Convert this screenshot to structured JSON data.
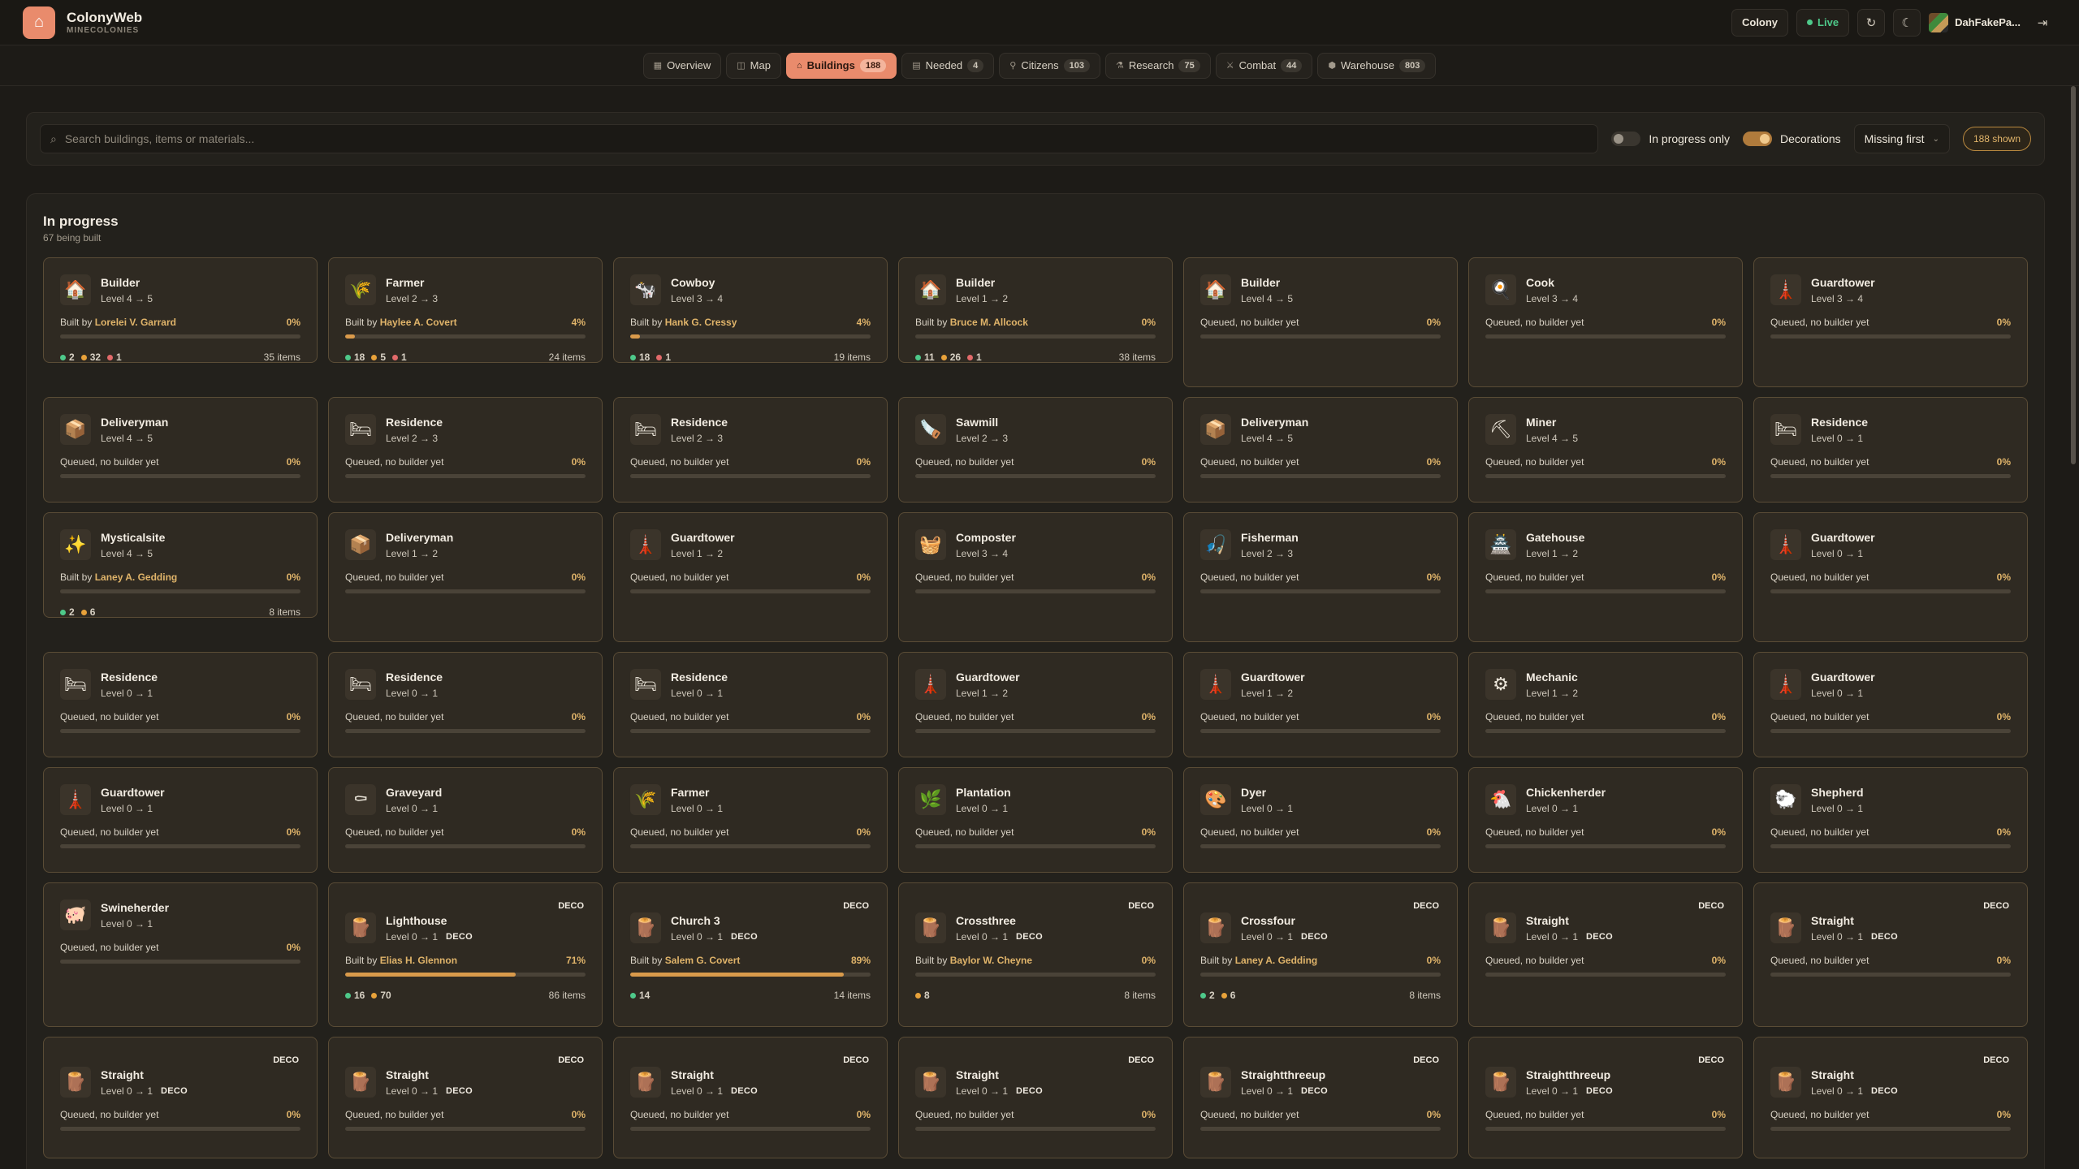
{
  "app": {
    "title": "ColonyWeb",
    "subtitle": "MINECOLONIES"
  },
  "header": {
    "colony_label": "Colony",
    "live_label": "Live",
    "user_name": "DahFakePa..."
  },
  "nav": [
    {
      "label": "Overview",
      "icon": "grid-icon",
      "glyph": "▦",
      "count": ""
    },
    {
      "label": "Map",
      "icon": "map-icon",
      "glyph": "◫",
      "count": ""
    },
    {
      "label": "Buildings",
      "icon": "building-icon",
      "glyph": "⌂",
      "count": "188",
      "active": true
    },
    {
      "label": "Needed",
      "icon": "clipboard-icon",
      "glyph": "▤",
      "count": "4"
    },
    {
      "label": "Citizens",
      "icon": "person-icon",
      "glyph": "⚲",
      "count": "103"
    },
    {
      "label": "Research",
      "icon": "flask-icon",
      "glyph": "⚗",
      "count": "75"
    },
    {
      "label": "Combat",
      "icon": "sword-icon",
      "glyph": "⚔",
      "count": "44"
    },
    {
      "label": "Warehouse",
      "icon": "box-icon",
      "glyph": "⬢",
      "count": "803"
    }
  ],
  "filters": {
    "search_placeholder": "Search buildings, items or materials...",
    "in_progress_label": "In progress only",
    "in_progress_on": false,
    "decorations_label": "Decorations",
    "decorations_on": true,
    "sort_value": "Missing first",
    "shown_label": "188 shown"
  },
  "section": {
    "title": "In progress",
    "subtitle": "67 being built"
  },
  "colors": {
    "accent": "#e98b6c",
    "gold": "#e0b46a",
    "green": "#4ec98a",
    "orange": "#e8a23a",
    "red": "#e26a6a"
  },
  "cards": [
    {
      "name": "Builder",
      "level": "Level 4 → 5",
      "icon": "🏠",
      "builder": "Lorelei V. Garrard",
      "pct": "0%",
      "progress": 0,
      "mats": [
        [
          "green",
          "2"
        ],
        [
          "orange",
          "32"
        ],
        [
          "red",
          "1"
        ]
      ],
      "items": "35 items"
    },
    {
      "name": "Farmer",
      "level": "Level 2 → 3",
      "icon": "🌾",
      "builder": "Haylee A. Covert",
      "pct": "4%",
      "progress": 4,
      "mats": [
        [
          "green",
          "18"
        ],
        [
          "orange",
          "5"
        ],
        [
          "red",
          "1"
        ]
      ],
      "items": "24 items"
    },
    {
      "name": "Cowboy",
      "level": "Level 3 → 4",
      "icon": "🐄",
      "builder": "Hank G. Cressy",
      "pct": "4%",
      "progress": 4,
      "mats": [
        [
          "green",
          "18"
        ],
        [
          "red",
          "1"
        ]
      ],
      "items": "19 items"
    },
    {
      "name": "Builder",
      "level": "Level 1 → 2",
      "icon": "🏠",
      "builder": "Bruce M. Allcock",
      "pct": "0%",
      "progress": 0,
      "mats": [
        [
          "green",
          "11"
        ],
        [
          "orange",
          "26"
        ],
        [
          "red",
          "1"
        ]
      ],
      "items": "38 items"
    },
    {
      "name": "Builder",
      "level": "Level 4 → 5",
      "icon": "🏠",
      "status": "Queued, no builder yet",
      "pct": "0%",
      "progress": 0,
      "tall": true
    },
    {
      "name": "Cook",
      "level": "Level 3 → 4",
      "icon": "🍳",
      "status": "Queued, no builder yet",
      "pct": "0%",
      "progress": 0,
      "tall": true
    },
    {
      "name": "Guardtower",
      "level": "Level 3 → 4",
      "icon": "🗼",
      "status": "Queued, no builder yet",
      "pct": "0%",
      "progress": 0,
      "tall": true
    },
    {
      "name": "Deliveryman",
      "level": "Level 4 → 5",
      "icon": "📦",
      "status": "Queued, no builder yet",
      "pct": "0%",
      "progress": 0
    },
    {
      "name": "Residence",
      "level": "Level 2 → 3",
      "icon": "🛏",
      "status": "Queued, no builder yet",
      "pct": "0%",
      "progress": 0
    },
    {
      "name": "Residence",
      "level": "Level 2 → 3",
      "icon": "🛏",
      "status": "Queued, no builder yet",
      "pct": "0%",
      "progress": 0
    },
    {
      "name": "Sawmill",
      "level": "Level 2 → 3",
      "icon": "🪚",
      "status": "Queued, no builder yet",
      "pct": "0%",
      "progress": 0
    },
    {
      "name": "Deliveryman",
      "level": "Level 4 → 5",
      "icon": "📦",
      "status": "Queued, no builder yet",
      "pct": "0%",
      "progress": 0
    },
    {
      "name": "Miner",
      "level": "Level 4 → 5",
      "icon": "⛏",
      "status": "Queued, no builder yet",
      "pct": "0%",
      "progress": 0
    },
    {
      "name": "Residence",
      "level": "Level 0 → 1",
      "icon": "🛏",
      "status": "Queued, no builder yet",
      "pct": "0%",
      "progress": 0
    },
    {
      "name": "Mysticalsite",
      "level": "Level 4 → 5",
      "icon": "✨",
      "builder": "Laney A. Gedding",
      "pct": "0%",
      "progress": 0,
      "mats": [
        [
          "green",
          "2"
        ],
        [
          "orange",
          "6"
        ]
      ],
      "items": "8 items"
    },
    {
      "name": "Deliveryman",
      "level": "Level 1 → 2",
      "icon": "📦",
      "status": "Queued, no builder yet",
      "pct": "0%",
      "progress": 0,
      "tall": true
    },
    {
      "name": "Guardtower",
      "level": "Level 1 → 2",
      "icon": "🗼",
      "status": "Queued, no builder yet",
      "pct": "0%",
      "progress": 0,
      "tall": true
    },
    {
      "name": "Composter",
      "level": "Level 3 → 4",
      "icon": "🧺",
      "status": "Queued, no builder yet",
      "pct": "0%",
      "progress": 0,
      "tall": true
    },
    {
      "name": "Fisherman",
      "level": "Level 2 → 3",
      "icon": "🎣",
      "status": "Queued, no builder yet",
      "pct": "0%",
      "progress": 0,
      "tall": true
    },
    {
      "name": "Gatehouse",
      "level": "Level 1 → 2",
      "icon": "🏯",
      "status": "Queued, no builder yet",
      "pct": "0%",
      "progress": 0,
      "tall": true
    },
    {
      "name": "Guardtower",
      "level": "Level 0 → 1",
      "icon": "🗼",
      "status": "Queued, no builder yet",
      "pct": "0%",
      "progress": 0,
      "tall": true
    },
    {
      "name": "Residence",
      "level": "Level 0 → 1",
      "icon": "🛏",
      "status": "Queued, no builder yet",
      "pct": "0%",
      "progress": 0
    },
    {
      "name": "Residence",
      "level": "Level 0 → 1",
      "icon": "🛏",
      "status": "Queued, no builder yet",
      "pct": "0%",
      "progress": 0
    },
    {
      "name": "Residence",
      "level": "Level 0 → 1",
      "icon": "🛏",
      "status": "Queued, no builder yet",
      "pct": "0%",
      "progress": 0
    },
    {
      "name": "Guardtower",
      "level": "Level 1 → 2",
      "icon": "🗼",
      "status": "Queued, no builder yet",
      "pct": "0%",
      "progress": 0
    },
    {
      "name": "Guardtower",
      "level": "Level 1 → 2",
      "icon": "🗼",
      "status": "Queued, no builder yet",
      "pct": "0%",
      "progress": 0
    },
    {
      "name": "Mechanic",
      "level": "Level 1 → 2",
      "icon": "⚙",
      "status": "Queued, no builder yet",
      "pct": "0%",
      "progress": 0
    },
    {
      "name": "Guardtower",
      "level": "Level 0 → 1",
      "icon": "🗼",
      "status": "Queued, no builder yet",
      "pct": "0%",
      "progress": 0
    },
    {
      "name": "Guardtower",
      "level": "Level 0 → 1",
      "icon": "🗼",
      "status": "Queued, no builder yet",
      "pct": "0%",
      "progress": 0
    },
    {
      "name": "Graveyard",
      "level": "Level 0 → 1",
      "icon": "⚰",
      "status": "Queued, no builder yet",
      "pct": "0%",
      "progress": 0
    },
    {
      "name": "Farmer",
      "level": "Level 0 → 1",
      "icon": "🌾",
      "status": "Queued, no builder yet",
      "pct": "0%",
      "progress": 0
    },
    {
      "name": "Plantation",
      "level": "Level 0 → 1",
      "icon": "🌿",
      "status": "Queued, no builder yet",
      "pct": "0%",
      "progress": 0
    },
    {
      "name": "Dyer",
      "level": "Level 0 → 1",
      "icon": "🎨",
      "status": "Queued, no builder yet",
      "pct": "0%",
      "progress": 0
    },
    {
      "name": "Chickenherder",
      "level": "Level 0 → 1",
      "icon": "🐔",
      "status": "Queued, no builder yet",
      "pct": "0%",
      "progress": 0
    },
    {
      "name": "Shepherd",
      "level": "Level 0 → 1",
      "icon": "🐑",
      "status": "Queued, no builder yet",
      "pct": "0%",
      "progress": 0
    },
    {
      "name": "Swineherder",
      "level": "Level 0 → 1",
      "icon": "🐖",
      "status": "Queued, no builder yet",
      "pct": "0%",
      "progress": 0,
      "deco_row": true
    },
    {
      "name": "Lighthouse",
      "level": "Level 0 → 1",
      "icon": "🪵",
      "deco": "DECO",
      "builder": "Elias H. Glennon",
      "pct": "71%",
      "progress": 71,
      "mats": [
        [
          "green",
          "16"
        ],
        [
          "orange",
          "70"
        ]
      ],
      "items": "86 items"
    },
    {
      "name": "Church 3",
      "level": "Level 0 → 1",
      "icon": "🪵",
      "deco": "DECO",
      "builder": "Salem G. Covert",
      "pct": "89%",
      "progress": 89,
      "mats": [
        [
          "green",
          "14"
        ]
      ],
      "items": "14 items"
    },
    {
      "name": "Crossthree",
      "level": "Level 0 → 1",
      "icon": "🪵",
      "deco": "DECO",
      "builder": "Baylor W. Cheyne",
      "pct": "0%",
      "progress": 0,
      "mats": [
        [
          "orange",
          "8"
        ]
      ],
      "items": "8 items"
    },
    {
      "name": "Crossfour",
      "level": "Level 0 → 1",
      "icon": "🪵",
      "deco": "DECO",
      "builder": "Laney A. Gedding",
      "pct": "0%",
      "progress": 0,
      "mats": [
        [
          "green",
          "2"
        ],
        [
          "orange",
          "6"
        ]
      ],
      "items": "8 items"
    },
    {
      "name": "Straight",
      "level": "Level 0 → 1",
      "icon": "🪵",
      "deco": "DECO",
      "status": "Queued, no builder yet",
      "pct": "0%",
      "progress": 0
    },
    {
      "name": "Straight",
      "level": "Level 0 → 1",
      "icon": "🪵",
      "deco": "DECO",
      "status": "Queued, no builder yet",
      "pct": "0%",
      "progress": 0
    },
    {
      "name": "Straight",
      "level": "Level 0 → 1",
      "icon": "🪵",
      "deco": "DECO",
      "status": "Queued, no builder yet",
      "pct": "0%",
      "progress": 0,
      "short": true
    },
    {
      "name": "Straight",
      "level": "Level 0 → 1",
      "icon": "🪵",
      "deco": "DECO",
      "status": "Queued, no builder yet",
      "pct": "0%",
      "progress": 0,
      "short": true
    },
    {
      "name": "Straight",
      "level": "Level 0 → 1",
      "icon": "🪵",
      "deco": "DECO",
      "status": "Queued, no builder yet",
      "pct": "0%",
      "progress": 0,
      "short": true
    },
    {
      "name": "Straight",
      "level": "Level 0 → 1",
      "icon": "🪵",
      "deco": "DECO",
      "status": "Queued, no builder yet",
      "pct": "0%",
      "progress": 0,
      "short": true
    },
    {
      "name": "Straightthreeup",
      "level": "Level 0 → 1",
      "icon": "🪵",
      "deco": "DECO",
      "status": "Queued, no builder yet",
      "pct": "0%",
      "progress": 0,
      "short": true
    },
    {
      "name": "Straightthreeup",
      "level": "Level 0 → 1",
      "icon": "🪵",
      "deco": "DECO",
      "status": "Queued, no builder yet",
      "pct": "0%",
      "progress": 0,
      "short": true
    },
    {
      "name": "Straight",
      "level": "Level 0 → 1",
      "icon": "🪵",
      "deco": "DECO",
      "status": "Queued, no builder yet",
      "pct": "0%",
      "progress": 0,
      "short": true
    }
  ]
}
